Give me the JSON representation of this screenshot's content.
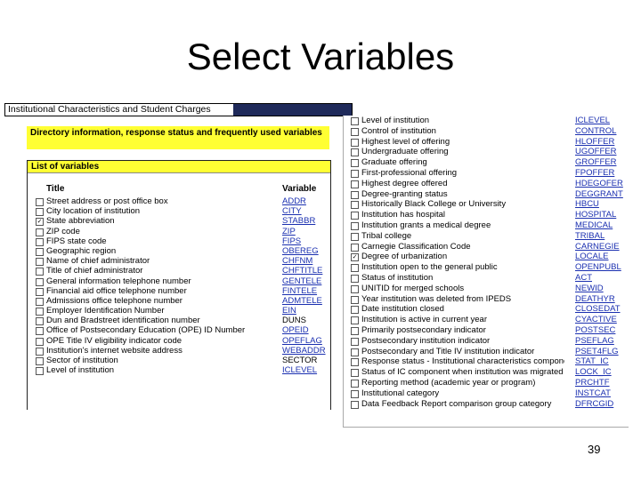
{
  "slide": {
    "title": "Select Variables",
    "page_number": "39"
  },
  "left_panel": {
    "section_bar": "Institutional Characteristics and Student Charges",
    "yellow_box": "Directory information, response status and frequently used variables",
    "list_header": "List of variables",
    "col_title": "Title",
    "col_variable": "Variable",
    "rows": [
      {
        "label": "Street address or post office box",
        "var": "ADDR",
        "link": true,
        "checked": false
      },
      {
        "label": "City location of institution",
        "var": "CITY",
        "link": true,
        "checked": false
      },
      {
        "label": "State abbreviation",
        "var": "STABBR",
        "link": true,
        "checked": true
      },
      {
        "label": "ZIP code",
        "var": "ZIP",
        "link": true,
        "checked": false
      },
      {
        "label": "FIPS state code",
        "var": "FIPS",
        "link": true,
        "checked": false
      },
      {
        "label": "Geographic region",
        "var": "OBEREG",
        "link": true,
        "checked": false
      },
      {
        "label": "Name of chief administrator",
        "var": "CHFNM",
        "link": true,
        "checked": false
      },
      {
        "label": "Title of chief administrator",
        "var": "CHFTITLE",
        "link": true,
        "checked": false
      },
      {
        "label": "General information telephone number",
        "var": "GENTELE",
        "link": true,
        "checked": false
      },
      {
        "label": "Financial aid office telephone number",
        "var": "FINTELE",
        "link": true,
        "checked": false
      },
      {
        "label": "Admissions office telephone number",
        "var": "ADMTELE",
        "link": true,
        "checked": false
      },
      {
        "label": "Employer Identification Number",
        "var": "EIN",
        "link": true,
        "checked": false
      },
      {
        "label": "Dun and Bradstreet identification number",
        "var": "DUNS",
        "link": false,
        "checked": false
      },
      {
        "label": "Office of Postsecondary Education (OPE) ID Number",
        "var": "OPEID",
        "link": true,
        "checked": false
      },
      {
        "label": "OPE Title IV eligibility indicator code",
        "var": "OPEFLAG",
        "link": true,
        "checked": false
      },
      {
        "label": "Institution's internet website address",
        "var": "WEBADDR",
        "link": true,
        "checked": false
      },
      {
        "label": "Sector of institution",
        "var": "SECTOR",
        "link": false,
        "checked": false
      },
      {
        "label": "Level of institution",
        "var": "ICLEVEL",
        "link": true,
        "checked": false
      }
    ]
  },
  "right_panel": {
    "first_var": "ICLEVEL",
    "rows": [
      {
        "label": "Level of institution",
        "var": "ICLEVEL",
        "checked": false
      },
      {
        "label": "Control of institution",
        "var": "CONTROL",
        "checked": false
      },
      {
        "label": "Highest level of offering",
        "var": "HLOFFER",
        "checked": false
      },
      {
        "label": "Undergraduate offering",
        "var": "UGOFFER",
        "checked": false
      },
      {
        "label": "Graduate offering",
        "var": "GROFFER",
        "checked": false
      },
      {
        "label": "First-professional offering",
        "var": "FPOFFER",
        "checked": false
      },
      {
        "label": "Highest degree offered",
        "var": "HDEGOFER",
        "checked": false
      },
      {
        "label": "Degree-granting status",
        "var": "DEGGRANT",
        "checked": false
      },
      {
        "label": "Historically Black College or University",
        "var": "HBCU",
        "checked": false
      },
      {
        "label": "Institution has hospital",
        "var": "HOSPITAL",
        "checked": false
      },
      {
        "label": "Institution grants a medical degree",
        "var": "MEDICAL",
        "checked": false
      },
      {
        "label": "Tribal college",
        "var": "TRIBAL",
        "checked": false
      },
      {
        "label": "Carnegie Classification Code",
        "var": "CARNEGIE",
        "checked": false
      },
      {
        "label": "Degree of urbanization",
        "var": "LOCALE",
        "checked": true
      },
      {
        "label": "Institution open to the general public",
        "var": "OPENPUBL",
        "checked": false
      },
      {
        "label": "Status of institution",
        "var": "ACT",
        "checked": false
      },
      {
        "label": "UNITID for merged schools",
        "var": "NEWID",
        "checked": false
      },
      {
        "label": "Year institution was deleted from IPEDS",
        "var": "DEATHYR",
        "checked": false
      },
      {
        "label": "Date institution closed",
        "var": "CLOSEDAT",
        "checked": false
      },
      {
        "label": "Institution is active in current year",
        "var": "CYACTIVE",
        "checked": false
      },
      {
        "label": "Primarily postsecondary indicator",
        "var": "POSTSEC",
        "checked": false
      },
      {
        "label": "Postsecondary institution indicator",
        "var": "PSEFLAG",
        "checked": false
      },
      {
        "label": "Postsecondary and Title IV institution indicator",
        "var": "PSET4FLG",
        "checked": false
      },
      {
        "label": "Response status - Institutional characteristics component",
        "var": "STAT_IC",
        "checked": false
      },
      {
        "label": "Status of IC component when institution was migrated",
        "var": "LOCK_IC",
        "checked": false
      },
      {
        "label": "Reporting method (academic year or program)",
        "var": "PRCHTF",
        "checked": false
      },
      {
        "label": "Institutional category",
        "var": "INSTCAT",
        "checked": false
      },
      {
        "label": "Data Feedback Report comparison group category",
        "var": "DFRCGID",
        "checked": false
      }
    ]
  }
}
